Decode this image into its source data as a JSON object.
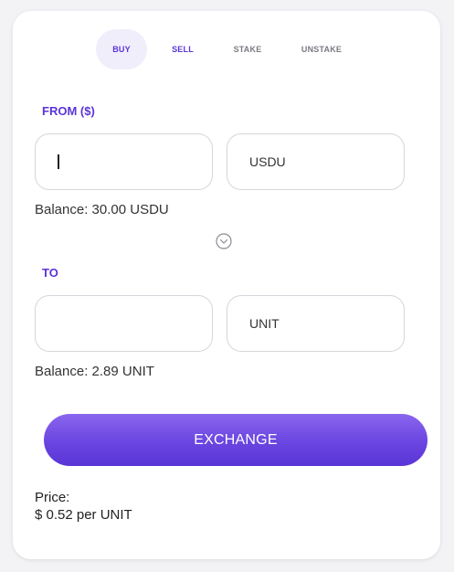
{
  "tabs": {
    "buy": "BUY",
    "sell": "SELL",
    "stake": "STAKE",
    "unstake": "UNSTAKE"
  },
  "from": {
    "label": "FROM ($)",
    "amount_value": "",
    "token": "USDU",
    "balance": "Balance: 30.00 USDU"
  },
  "to": {
    "label": "TO",
    "amount_value": "",
    "token": "UNIT",
    "balance": "Balance: 2.89 UNIT"
  },
  "swap_icon": "chevron-down-circle-icon",
  "exchange_label": "EXCHANGE",
  "price": {
    "label": "Price:",
    "value": "$ 0.52 per UNIT"
  },
  "colors": {
    "accent": "#5b34d8",
    "button_top": "#8b66ee",
    "button_bottom": "#5a35d6"
  }
}
